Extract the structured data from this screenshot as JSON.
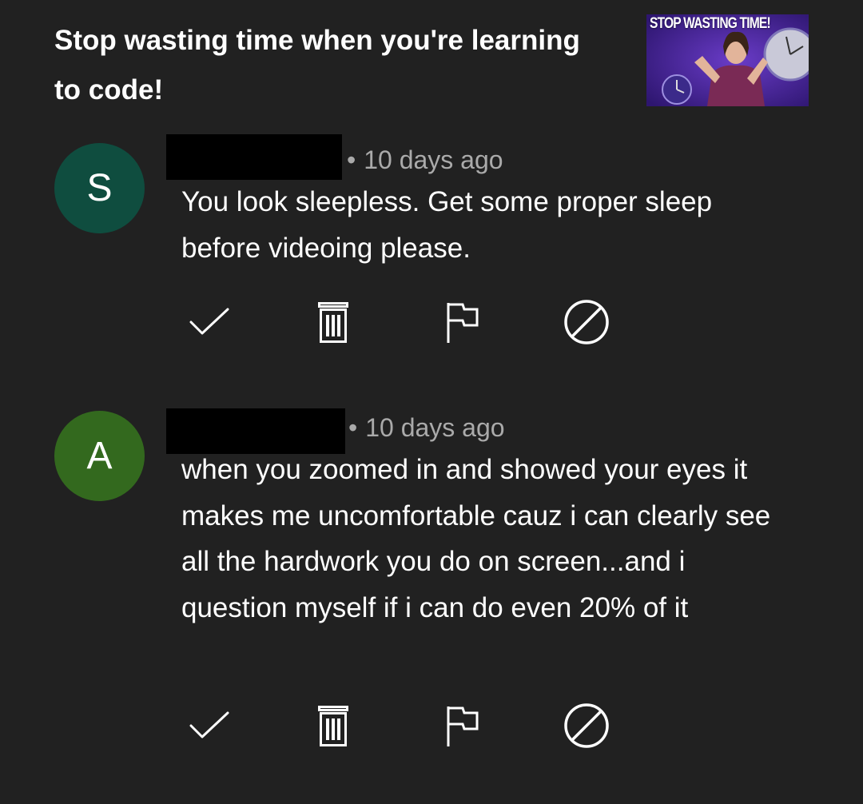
{
  "video": {
    "title": "Stop wasting time when you're learning to code!",
    "thumbnail_text": "STOP WASTING TIME!"
  },
  "comments": [
    {
      "avatar_letter": "S",
      "avatar_color": "#0f4d3f",
      "time": "10 days ago",
      "text": "You look sleepless. Get some proper sleep before videoing please."
    },
    {
      "avatar_letter": "A",
      "avatar_color": "#33691e",
      "time": "10 days ago",
      "text": "when you zoomed in and showed your eyes it makes me uncomfortable cauz i can clearly see all the hardwork you do on screen...and i question myself if i can do even 20% of it"
    }
  ],
  "actions": {
    "approve_icon": "check-icon",
    "delete_icon": "trash-icon",
    "report_icon": "flag-icon",
    "hide_user_icon": "block-icon"
  },
  "colors": {
    "background": "#212121",
    "meta_text": "#aaaaaa",
    "icon": "#ffffff"
  }
}
